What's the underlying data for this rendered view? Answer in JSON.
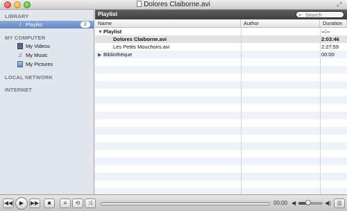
{
  "window": {
    "title": "Dolores Claiborne.avi"
  },
  "sidebar": {
    "library": {
      "header": "LIBRARY",
      "items": [
        {
          "label": "Playlist",
          "badge": "2",
          "icon": "playlist-icon",
          "selected": true
        }
      ]
    },
    "my_computer": {
      "header": "MY COMPUTER",
      "items": [
        {
          "label": "My Videos",
          "icon": "video-icon"
        },
        {
          "label": "My Music",
          "icon": "music-icon"
        },
        {
          "label": "My Pictures",
          "icon": "pictures-icon"
        }
      ]
    },
    "local_network": {
      "header": "LOCAL NETWORK"
    },
    "internet": {
      "header": "INTERNET"
    }
  },
  "main": {
    "header_title": "Playlist",
    "search": {
      "placeholder": "Search",
      "value": ""
    },
    "columns": {
      "name": "Name",
      "author": "Author",
      "duration": "Duration"
    },
    "rows": [
      {
        "name": "Playlist",
        "author": "",
        "duration": "--:--",
        "level": 0,
        "expander": "▼",
        "bold": true
      },
      {
        "name": "Dolores Claiborne.avi",
        "author": "",
        "duration": "2:03:46",
        "level": 1,
        "expander": "",
        "bold": true,
        "selected": true
      },
      {
        "name": "Les Petits Mouchoirs.avi",
        "author": "",
        "duration": "2:27:59",
        "level": 1,
        "expander": "",
        "bold": false
      },
      {
        "name": "Bibliothèque",
        "author": "",
        "duration": "00:00",
        "level": 0,
        "expander": "▶",
        "bold": false
      }
    ]
  },
  "controls": {
    "rewind": "◀◀",
    "play": "▶",
    "forward": "▶▶",
    "stop": "■",
    "playlist_toggle": "≡",
    "loop": "⟲",
    "shuffle": "⤨",
    "time": "00:00",
    "volume_level": 0.4,
    "volume_min_icon": "◀",
    "fullscreen": "|||"
  },
  "colors": {
    "sidebar_bg": "#e1e6ed",
    "selection": "#6486c4",
    "header_dark": "#4a4a4a",
    "row_alt": "#eef3fa"
  }
}
